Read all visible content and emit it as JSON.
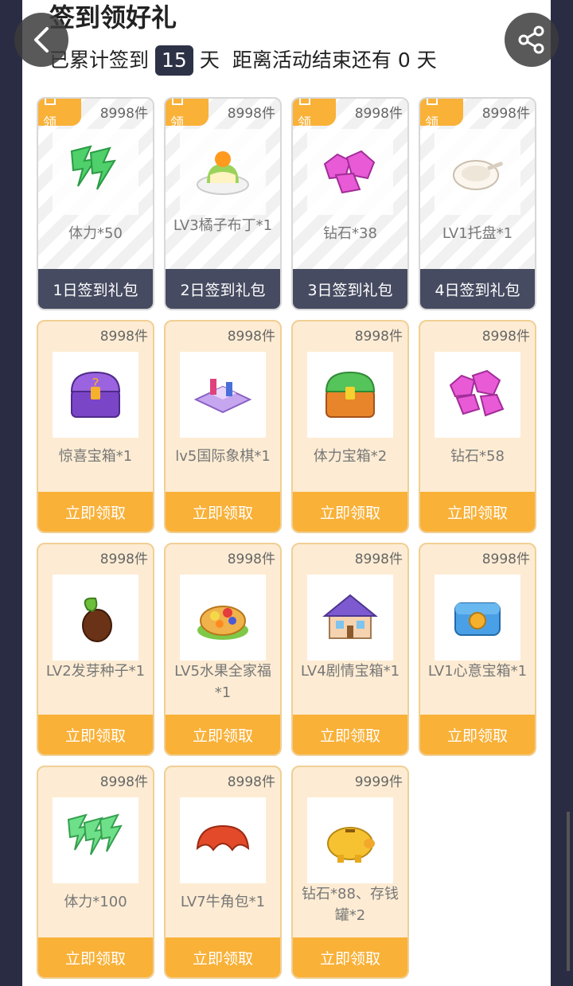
{
  "header": {
    "title": "签到领好礼",
    "signed_prefix": "已累计签到",
    "signed_days": "15",
    "signed_unit": "天",
    "end_prefix": "距离活动结束还有",
    "end_days": "0",
    "end_unit": "天"
  },
  "nav": {
    "back_icon": "back-arrow-icon",
    "share_icon": "share-icon"
  },
  "colors": {
    "accent": "#f9b138",
    "dark_footer": "#464b61",
    "claim_bg": "#fdecd3"
  },
  "signin_cards": [
    {
      "tag": "领",
      "count": "8998件",
      "name": "体力*50",
      "footer": "1日签到礼包",
      "icon": "energy-bolts-icon"
    },
    {
      "tag": "领",
      "count": "8998件",
      "name": "LV3橘子布丁*1",
      "footer": "2日签到礼包",
      "icon": "orange-pudding-icon"
    },
    {
      "tag": "领",
      "count": "8998件",
      "name": "钻石*38",
      "footer": "3日签到礼包",
      "icon": "diamonds-icon"
    },
    {
      "tag": "领",
      "count": "8998件",
      "name": "LV1托盘*1",
      "footer": "4日签到礼包",
      "icon": "tray-icon"
    }
  ],
  "claim_cards": [
    {
      "count": "8998件",
      "name": "惊喜宝箱*1",
      "footer": "立即领取",
      "icon": "surprise-chest-icon"
    },
    {
      "count": "8998件",
      "name": "lv5国际象棋*1",
      "footer": "立即领取",
      "icon": "chess-board-icon"
    },
    {
      "count": "8998件",
      "name": "体力宝箱*2",
      "footer": "立即领取",
      "icon": "energy-chest-icon"
    },
    {
      "count": "8998件",
      "name": "钻石*58",
      "footer": "立即领取",
      "icon": "diamonds-icon"
    },
    {
      "count": "8998件",
      "name": "LV2发芽种子*1",
      "footer": "立即领取",
      "icon": "sprout-seed-icon"
    },
    {
      "count": "8998件",
      "name": "LV5水果全家福*1",
      "footer": "立即领取",
      "icon": "fruit-tart-icon"
    },
    {
      "count": "8998件",
      "name": "LV4剧情宝箱*1",
      "footer": "立即领取",
      "icon": "story-house-icon"
    },
    {
      "count": "8998件",
      "name": "LV1心意宝箱*1",
      "footer": "立即领取",
      "icon": "coin-chest-icon"
    },
    {
      "count": "8998件",
      "name": "体力*100",
      "footer": "立即领取",
      "icon": "energy-bolts-icon"
    },
    {
      "count": "8998件",
      "name": "LV7牛角包*1",
      "footer": "立即领取",
      "icon": "croissant-icon"
    },
    {
      "count": "9999件",
      "name": "钻石*88、存钱罐*2",
      "footer": "立即领取",
      "icon": "piggy-bank-icon"
    }
  ]
}
